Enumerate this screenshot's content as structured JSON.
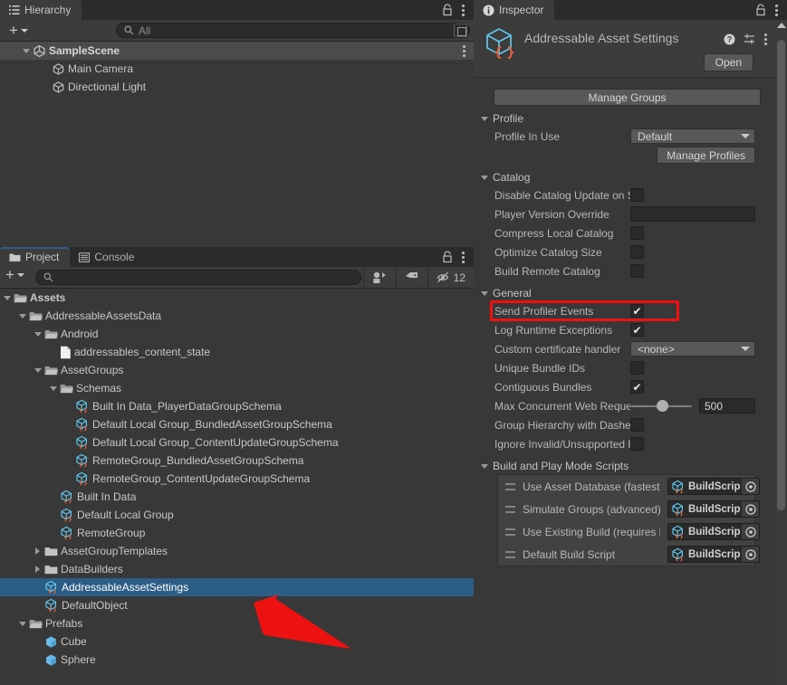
{
  "hierarchy": {
    "tab_label": "Hierarchy",
    "tab_icon": "hierarchy-icon",
    "add_label": "+",
    "search_placeholder": "All",
    "items": [
      {
        "label": "SampleScene",
        "icon": "unity-scene-icon",
        "indent": 1,
        "twisty": "open",
        "style": "scene"
      },
      {
        "label": "Main Camera",
        "icon": "gameobject-icon",
        "indent": 2,
        "twisty": "none",
        "style": "normal"
      },
      {
        "label": "Directional Light",
        "icon": "gameobject-icon",
        "indent": 2,
        "twisty": "none",
        "style": "normal"
      }
    ]
  },
  "project": {
    "tabs": [
      {
        "label": "Project",
        "icon": "folder-icon",
        "active": true
      },
      {
        "label": "Console",
        "icon": "console-icon",
        "active": false
      }
    ],
    "add_label": "+",
    "search_placeholder": "",
    "hidden_count": "12",
    "items": [
      {
        "label": "Assets",
        "icon": "folder-open-icon",
        "indent": 0,
        "twisty": "open",
        "bold": true
      },
      {
        "label": "AddressableAssetsData",
        "icon": "folder-open-icon",
        "indent": 1,
        "twisty": "open",
        "bold": false
      },
      {
        "label": "Android",
        "icon": "folder-open-icon",
        "indent": 2,
        "twisty": "open",
        "bold": false
      },
      {
        "label": "addressables_content_state",
        "icon": "file-icon",
        "indent": 3,
        "twisty": "none",
        "bold": false
      },
      {
        "label": "AssetGroups",
        "icon": "folder-open-icon",
        "indent": 2,
        "twisty": "open",
        "bold": false
      },
      {
        "label": "Schemas",
        "icon": "folder-open-icon",
        "indent": 3,
        "twisty": "open",
        "bold": false
      },
      {
        "label": "Built In Data_PlayerDataGroupSchema",
        "icon": "scriptable-object-icon",
        "indent": 4,
        "twisty": "none",
        "bold": false
      },
      {
        "label": "Default Local Group_BundledAssetGroupSchema",
        "icon": "scriptable-object-icon",
        "indent": 4,
        "twisty": "none",
        "bold": false
      },
      {
        "label": "Default Local Group_ContentUpdateGroupSchema",
        "icon": "scriptable-object-icon",
        "indent": 4,
        "twisty": "none",
        "bold": false
      },
      {
        "label": "RemoteGroup_BundledAssetGroupSchema",
        "icon": "scriptable-object-icon",
        "indent": 4,
        "twisty": "none",
        "bold": false
      },
      {
        "label": "RemoteGroup_ContentUpdateGroupSchema",
        "icon": "scriptable-object-icon",
        "indent": 4,
        "twisty": "none",
        "bold": false
      },
      {
        "label": "Built In Data",
        "icon": "scriptable-object-icon",
        "indent": 3,
        "twisty": "none",
        "bold": false
      },
      {
        "label": "Default Local Group",
        "icon": "scriptable-object-icon",
        "indent": 3,
        "twisty": "none",
        "bold": false
      },
      {
        "label": "RemoteGroup",
        "icon": "scriptable-object-icon",
        "indent": 3,
        "twisty": "none",
        "bold": false
      },
      {
        "label": "AssetGroupTemplates",
        "icon": "folder-icon",
        "indent": 2,
        "twisty": "closed",
        "bold": false
      },
      {
        "label": "DataBuilders",
        "icon": "folder-icon",
        "indent": 2,
        "twisty": "closed",
        "bold": false
      },
      {
        "label": "AddressableAssetSettings",
        "icon": "scriptable-object-icon",
        "indent": 2,
        "twisty": "none",
        "bold": false,
        "selected": true
      },
      {
        "label": "DefaultObject",
        "icon": "scriptable-object-icon",
        "indent": 2,
        "twisty": "none",
        "bold": false
      },
      {
        "label": "Prefabs",
        "icon": "folder-open-icon",
        "indent": 1,
        "twisty": "open",
        "bold": false
      },
      {
        "label": "Cube",
        "icon": "prefab-icon",
        "indent": 2,
        "twisty": "none",
        "bold": false
      },
      {
        "label": "Sphere",
        "icon": "prefab-icon",
        "indent": 2,
        "twisty": "none",
        "bold": false
      }
    ]
  },
  "inspector": {
    "tab_label": "Inspector",
    "tab_icon": "info-icon",
    "asset_title": "Addressable Asset Settings",
    "asset_icon": "scriptable-object-icon",
    "open_label": "Open",
    "manage_groups_label": "Manage Groups",
    "sections": [
      {
        "title": "Profile",
        "fields": [
          {
            "label": "Profile In Use",
            "type": "dropdown",
            "value": "Default"
          },
          {
            "label": "Manage Profiles",
            "type": "button"
          }
        ]
      },
      {
        "title": "Catalog",
        "fields": [
          {
            "label": "Disable Catalog Update on Startup",
            "type": "checkbox",
            "value": false
          },
          {
            "label": "Player Version Override",
            "type": "text",
            "value": ""
          },
          {
            "label": "Compress Local Catalog",
            "type": "checkbox",
            "value": false
          },
          {
            "label": "Optimize Catalog Size",
            "type": "checkbox",
            "value": false
          },
          {
            "label": "Build Remote Catalog",
            "type": "checkbox",
            "value": false
          }
        ]
      },
      {
        "title": "General",
        "fields": [
          {
            "label": "Send Profiler Events",
            "type": "checkbox",
            "value": true,
            "highlighted": true
          },
          {
            "label": "Log Runtime Exceptions",
            "type": "checkbox",
            "value": true
          },
          {
            "label": "Custom certificate handler",
            "type": "dropdown",
            "value": "<none>"
          },
          {
            "label": "Unique Bundle IDs",
            "type": "checkbox",
            "value": false
          },
          {
            "label": "Contiguous Bundles",
            "type": "checkbox",
            "value": true
          },
          {
            "label": "Max Concurrent Web Requests",
            "type": "slider",
            "value": "500"
          },
          {
            "label": "Group Hierarchy with Dashes",
            "type": "checkbox",
            "value": false
          },
          {
            "label": "Ignore Invalid/Unsupported Files in Build",
            "type": "checkbox",
            "value": false
          }
        ]
      }
    ],
    "build_section": {
      "title": "Build and Play Mode Scripts",
      "rows": [
        {
          "label": "Use Asset Database (fastest)",
          "value": "BuildScript"
        },
        {
          "label": "Simulate Groups (advanced)",
          "value": "BuildScript"
        },
        {
          "label": "Use Existing Build (requires bu",
          "value": "BuildScript"
        },
        {
          "label": "Default Build Script",
          "value": "BuildScript"
        }
      ]
    }
  },
  "colors": {
    "selection_blue": "#2c5d87",
    "highlight_red": "#ee1111",
    "panel_bg": "#383838",
    "toolbar_bg": "#3c3c3c",
    "tabbar_bg": "#2b2b2b",
    "icon_cyan": "#5ec3e8",
    "icon_orange": "#e8603c"
  }
}
